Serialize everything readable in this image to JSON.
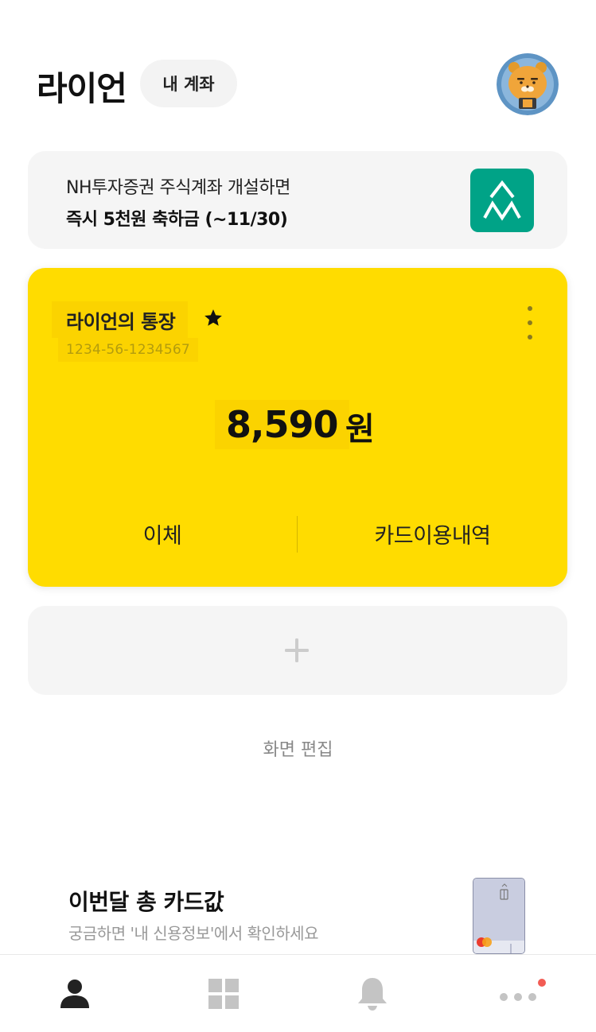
{
  "header": {
    "user_name": "라이언",
    "account_chip_label": "내 계좌"
  },
  "promo": {
    "line1": "NH투자증권 주식계좌 개설하면",
    "line2": "즉시 5천원 축하금 (~11/30)",
    "logo_icon": "nh-investment-logo-icon",
    "logo_color": "#00a387"
  },
  "account_card": {
    "name": "라이언의 통장",
    "number": "1234-56-1234567",
    "balance": "8,590",
    "currency": "원",
    "transfer_label": "이체",
    "card_history_label": "카드이용내역",
    "background_color": "#ffdc00"
  },
  "edit_screen_label": "화면 편집",
  "card_banner": {
    "title": "이번달 총 카드값",
    "subtitle": "궁금하면 '내 신용정보'에서 확인하세요"
  },
  "tabbar": {
    "items": [
      "person-icon",
      "grid-icon",
      "bell-icon",
      "more-icon"
    ],
    "active_index": 0,
    "notification_dot_color": "#f25c54"
  }
}
